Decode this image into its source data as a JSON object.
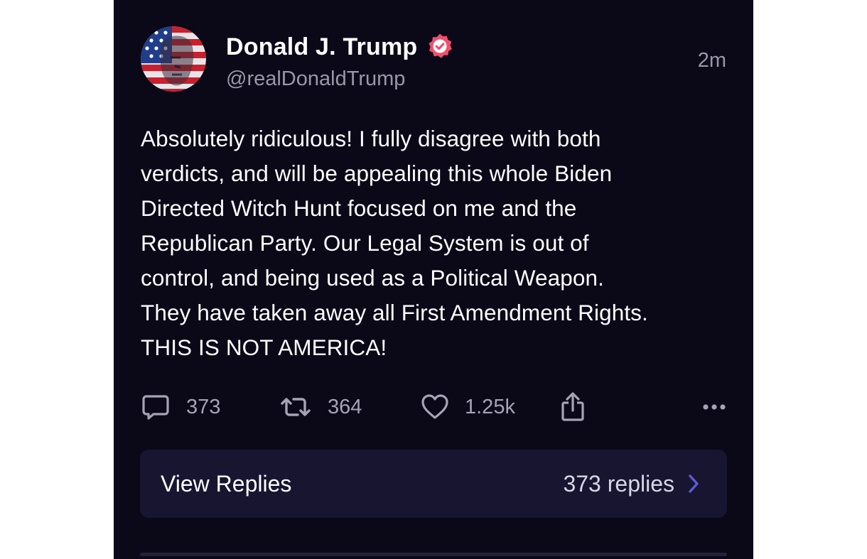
{
  "post": {
    "author_name": "Donald J. Trump",
    "author_handle": "@realDonaldTrump",
    "timestamp": "2m",
    "body": "Absolutely ridiculous! I fully disagree with both\nverdicts, and will be appealing this whole Biden\nDirected Witch Hunt focused on me and the\nRepublican Party. Our Legal System is out of\ncontrol, and being used as a Political Weapon.\nThey have taken away all First Amendment Rights.\nTHIS IS NOT AMERICA!",
    "verified_badge_color": "#f0506e",
    "avatar_icon": "avatar-flag-portrait"
  },
  "actions": {
    "reply_icon": "reply-icon",
    "reply_count": "373",
    "repost_icon": "repost-icon",
    "repost_count": "364",
    "like_icon": "heart-icon",
    "like_count": "1.25k",
    "share_icon": "share-icon",
    "more_icon": "more-icon"
  },
  "replies": {
    "label": "View Replies",
    "count_text": "373 replies",
    "chevron_color": "#5b5bd6"
  },
  "colors": {
    "background": "#0b0818",
    "panel": "#171530",
    "muted_text": "#9a98a8"
  }
}
